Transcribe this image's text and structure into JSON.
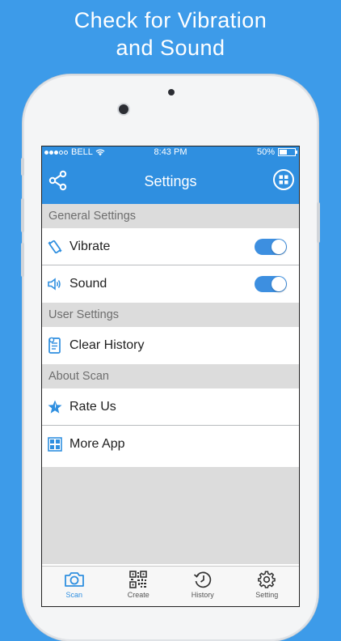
{
  "headline": {
    "line1": "Check for Vibration",
    "line2": "and Sound"
  },
  "status_bar": {
    "carrier": "BELL",
    "time": "8:43 PM",
    "battery": "50%",
    "battery_level": 0.5,
    "signal_dots_filled": 3,
    "signal_dots_total": 5
  },
  "nav": {
    "title": "Settings",
    "left_icon": "share-icon",
    "right_icon": "grid-icon"
  },
  "sections": [
    {
      "header": "General Settings",
      "rows": [
        {
          "label": "Vibrate",
          "icon": "vibrate-icon",
          "toggle": true
        },
        {
          "label": "Sound",
          "icon": "speaker-icon",
          "toggle": true
        }
      ]
    },
    {
      "header": "User Settings",
      "rows": [
        {
          "label": "Clear History",
          "icon": "clear-history-icon"
        }
      ]
    },
    {
      "header": "About Scan",
      "rows": [
        {
          "label": "Rate Us",
          "icon": "star-icon"
        },
        {
          "label": "More App",
          "icon": "apps-grid-icon"
        }
      ]
    }
  ],
  "tabs": [
    {
      "label": "Scan",
      "icon": "camera-icon",
      "active": true
    },
    {
      "label": "Create",
      "icon": "qr-code-icon",
      "active": false
    },
    {
      "label": "History",
      "icon": "history-icon",
      "active": false
    },
    {
      "label": "Setting",
      "icon": "gear-icon",
      "active": false
    }
  ],
  "colors": {
    "background": "#3d9be9",
    "accent": "#2f8fe0",
    "section_bg": "#dcdcdc"
  }
}
